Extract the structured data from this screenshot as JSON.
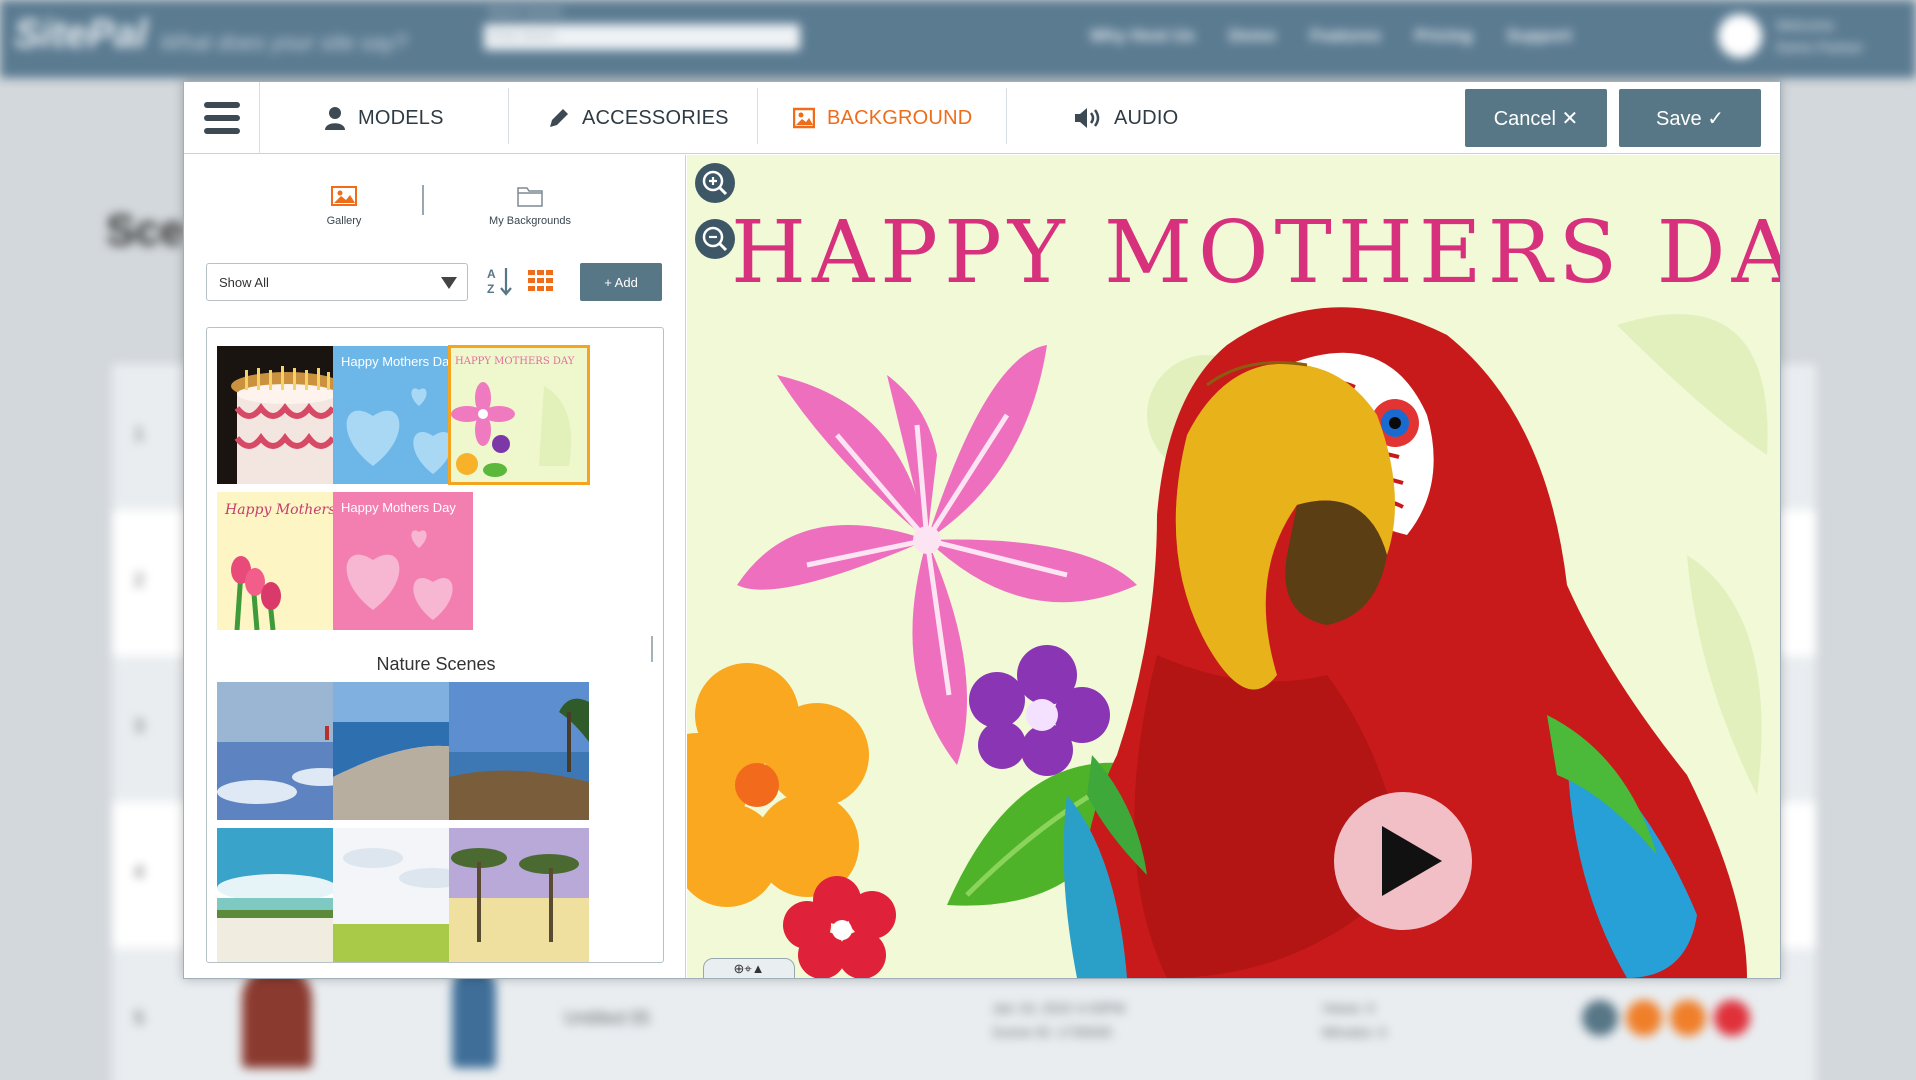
{
  "toolbar": {
    "tabs": [
      {
        "label": "MODELS"
      },
      {
        "label": "ACCESSORIES"
      },
      {
        "label": "BACKGROUND"
      },
      {
        "label": "AUDIO"
      }
    ],
    "cancel_label": "Cancel ✕",
    "save_label": "Save ✓"
  },
  "left_panel": {
    "tabs": [
      {
        "label": "Gallery",
        "icon": "image-icon"
      },
      {
        "label": "My Backgrounds",
        "icon": "folder-icon"
      }
    ],
    "filter": {
      "selected": "Show All"
    },
    "add_label": "+ Add",
    "section_label": "Nature Scenes"
  },
  "preview": {
    "title_text": "HAPPY MOTHERS DAY",
    "controls_label": "⊕⌖▲"
  },
  "background_page": {
    "logo": "SitePal",
    "tagline": "What does your site say?",
    "search_label": "Search Scenes",
    "search_placeholder": "Enter Search",
    "nav": [
      "Why Host Us",
      "Demo",
      "Features",
      "Pricing",
      "Support"
    ],
    "user_line1": "Welcome",
    "user_line2": "Demo Partner",
    "page_title": "Sce",
    "row_numbers": [
      "1",
      "2",
      "3",
      "4",
      "5"
    ],
    "row5_name": "Untitled 05",
    "row5_date_line1": "Jan 19, 2022 4:33PM",
    "row5_date_line2": "Scene ID: 1735930",
    "row5_views_line1": "Views: 0",
    "row5_views_line2": "Minutes: 0"
  },
  "colors": {
    "accent": "#ef6c1a",
    "button": "#577686",
    "header": "#5b7b91",
    "selected_outline": "#f4a420"
  }
}
